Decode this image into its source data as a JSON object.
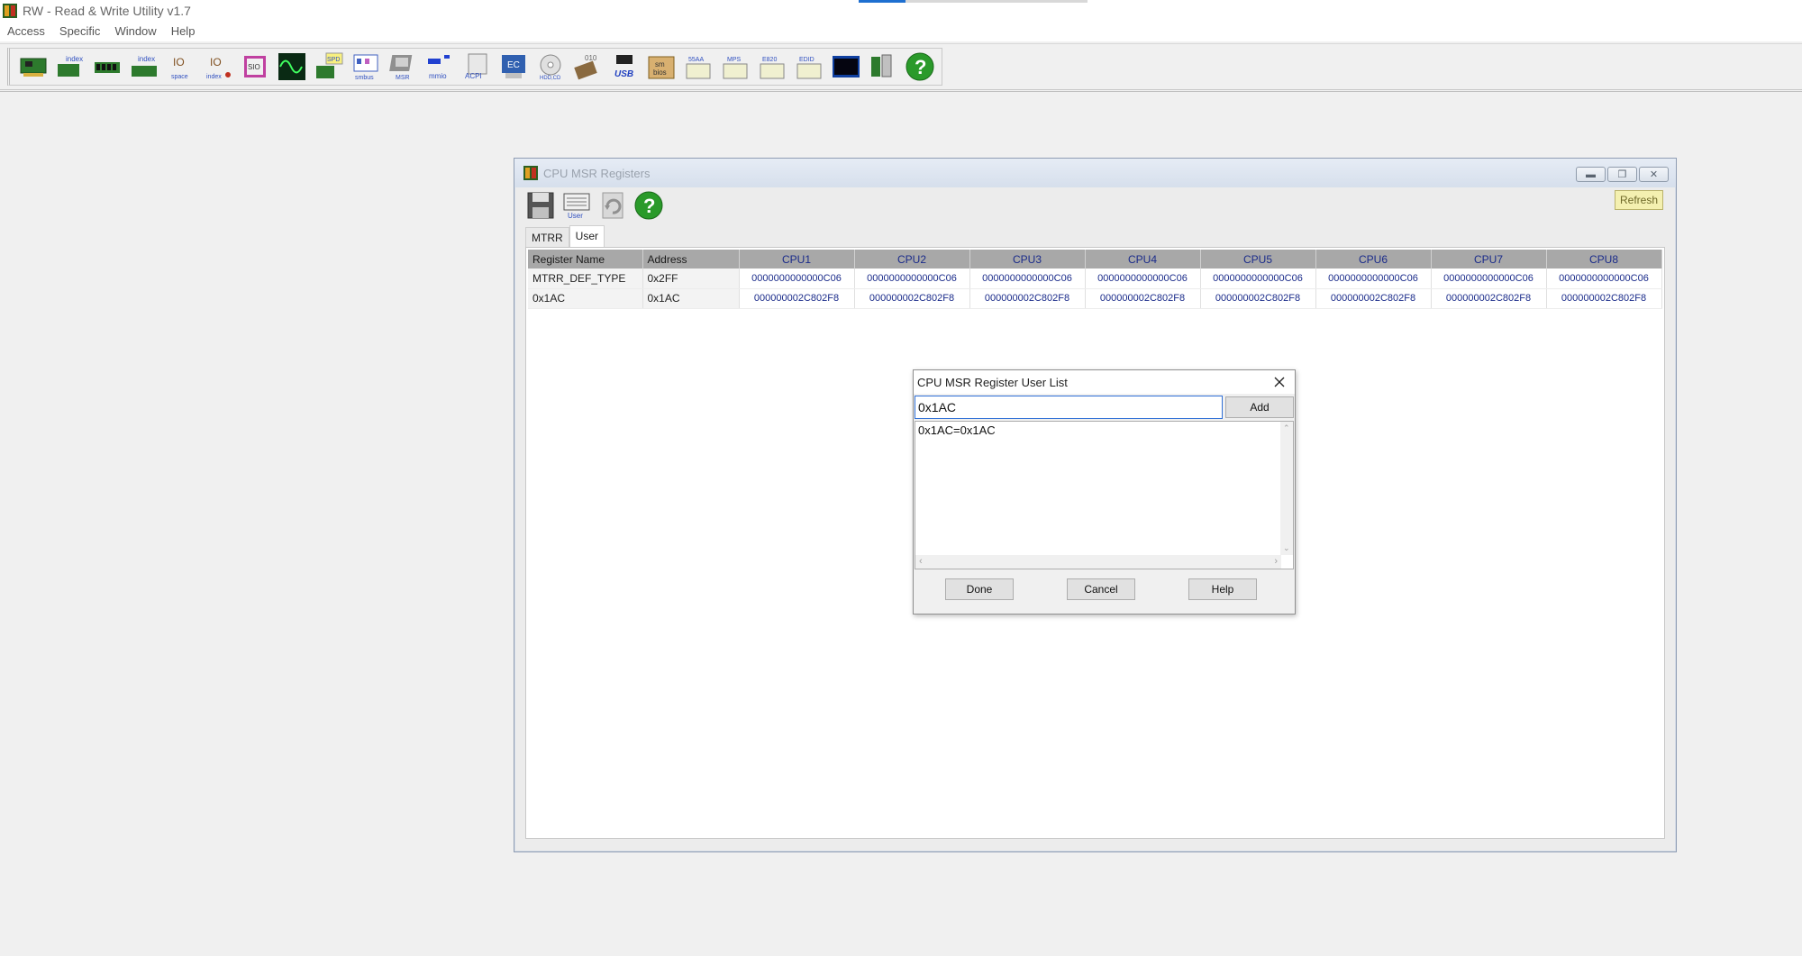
{
  "app": {
    "title": "RW - Read & Write Utility v1.7"
  },
  "menu": {
    "items": [
      "Access",
      "Specific",
      "Window",
      "Help"
    ]
  },
  "toolbar": {
    "icons": [
      "pci-card-icon",
      "index-pci-icon",
      "memory-module-icon",
      "index-memory-icon",
      "io-space-icon",
      "io-index-icon",
      "sio-icon",
      "oscilloscope-icon",
      "spd-icon",
      "smbus-icon",
      "msr-icon",
      "mmio-icon",
      "acpi-icon",
      "ec-icon",
      "hdd-cd-icon",
      "disk-010-icon",
      "usb-icon",
      "smbios-icon",
      "55aa-icon",
      "mps-icon",
      "e820-icon",
      "edid-icon",
      "console-icon",
      "tool-icon",
      "help-icon"
    ],
    "labels": {
      "index": "index",
      "space": "space",
      "io": "IO",
      "sio": "SIO",
      "spd": "SPD",
      "smbus": "smbus",
      "msr": "MSR",
      "mmio": "mmio",
      "acpi": "ACPI",
      "ec": "EC",
      "hddcd": "HDD,CD",
      "disk": "010",
      "usb": "USB",
      "sm": "sm",
      "bios": "bios",
      "aa": "55AA",
      "mps": "MPS",
      "e820": "E820",
      "edid": "EDID"
    }
  },
  "msr_window": {
    "title": "CPU MSR Registers",
    "toolbar_labels": {
      "user": "User"
    },
    "refresh_label": "Refresh",
    "tabs": [
      {
        "label": "MTRR",
        "active": false
      },
      {
        "label": "User",
        "active": true
      }
    ],
    "table": {
      "columns": [
        "Register Name",
        "Address",
        "CPU1",
        "CPU2",
        "CPU3",
        "CPU4",
        "CPU5",
        "CPU6",
        "CPU7",
        "CPU8"
      ],
      "rows": [
        {
          "name": "MTRR_DEF_TYPE",
          "address": "0x2FF",
          "values": [
            "0000000000000C06",
            "0000000000000C06",
            "0000000000000C06",
            "0000000000000C06",
            "0000000000000C06",
            "0000000000000C06",
            "0000000000000C06",
            "0000000000000C06"
          ]
        },
        {
          "name": "0x1AC",
          "address": "0x1AC",
          "values": [
            "000000002C802F8",
            "000000002C802F8",
            "000000002C802F8",
            "000000002C802F8",
            "000000002C802F8",
            "000000002C802F8",
            "000000002C802F8",
            "000000002C802F8"
          ]
        }
      ]
    }
  },
  "dialog": {
    "title": "CPU MSR Register User List",
    "input_value": "0x1AC",
    "add_label": "Add",
    "list_items": [
      "0x1AC=0x1AC"
    ],
    "done_label": "Done",
    "cancel_label": "Cancel",
    "help_label": "Help"
  }
}
